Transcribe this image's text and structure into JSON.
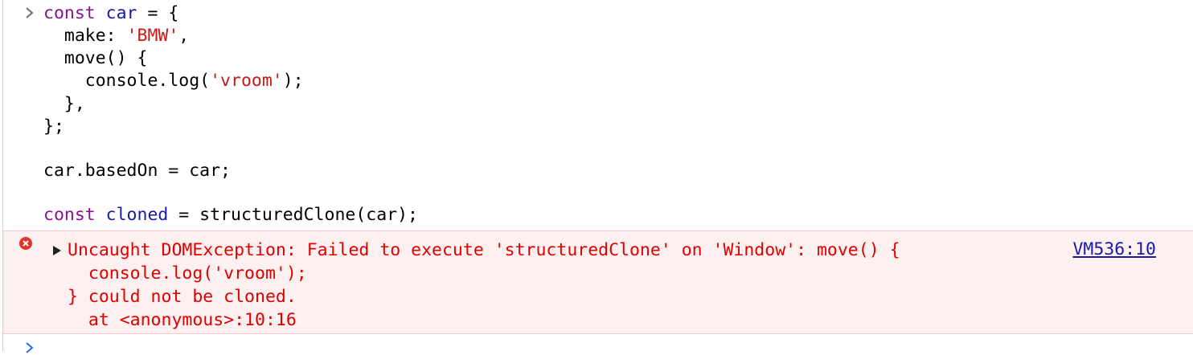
{
  "input": {
    "lines": [
      [
        {
          "t": "const ",
          "c": "kw"
        },
        {
          "t": "car",
          "c": "var"
        },
        {
          "t": " = {",
          "c": "plain"
        }
      ],
      [
        {
          "t": "  make: ",
          "c": "plain"
        },
        {
          "t": "'BMW'",
          "c": "str"
        },
        {
          "t": ",",
          "c": "plain"
        }
      ],
      [
        {
          "t": "  move() {",
          "c": "plain"
        }
      ],
      [
        {
          "t": "    console.log(",
          "c": "plain"
        },
        {
          "t": "'vroom'",
          "c": "str"
        },
        {
          "t": ");",
          "c": "plain"
        }
      ],
      [
        {
          "t": "  },",
          "c": "plain"
        }
      ],
      [
        {
          "t": "};",
          "c": "plain"
        }
      ],
      [],
      [
        {
          "t": "car.basedOn = car;",
          "c": "plain"
        }
      ],
      [],
      [
        {
          "t": "const ",
          "c": "kw"
        },
        {
          "t": "cloned",
          "c": "var"
        },
        {
          "t": " = structuredClone(car);",
          "c": "plain"
        }
      ]
    ]
  },
  "error": {
    "line1": "Uncaught DOMException: Failed to execute 'structuredClone' on 'Window': move() {",
    "line2": "  console.log('vroom');",
    "line3": "} could not be cloned.",
    "line4": "  at <anonymous>:10:16",
    "source": "VM536:10"
  },
  "colors": {
    "keyword": "#881391",
    "variable": "#1a1aa6",
    "string": "#c41a16",
    "error_text": "#e00000",
    "error_bg": "#fdf0f0",
    "link": "#1a1aa6"
  },
  "icons": {
    "prompt": "chevron-right-icon",
    "error": "error-circle-icon",
    "expand": "triangle-right-icon"
  }
}
